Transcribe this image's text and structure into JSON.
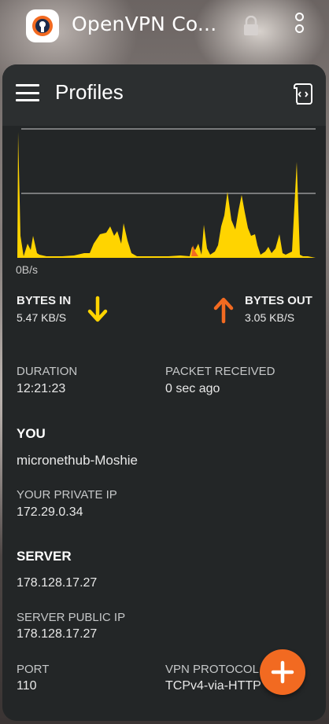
{
  "window": {
    "app_title": "OpenVPN Co...",
    "icons": [
      "openvpn-logo",
      "lock-icon",
      "overflow-menu-icon"
    ]
  },
  "appbar": {
    "title": "Profiles",
    "icons": [
      "hamburger-menu-icon",
      "log-icon"
    ]
  },
  "graph": {
    "axis_label": "0B/s",
    "colors": {
      "incoming": "#ffd400",
      "outgoing": "#f26a21",
      "grid": "#cfcfcf"
    }
  },
  "traffic": {
    "bytes_in_label": "BYTES IN",
    "bytes_in_value": "5.47 KB/S",
    "bytes_out_label": "BYTES OUT",
    "bytes_out_value": "3.05 KB/S"
  },
  "stats": {
    "duration_label": "DURATION",
    "duration_value": "12:21:23",
    "packet_label": "PACKET RECEIVED",
    "packet_value": "0 sec ago"
  },
  "you": {
    "section": "YOU",
    "username": "micronethub-Moshie",
    "private_ip_label": "YOUR PRIVATE IP",
    "private_ip_value": "172.29.0.34"
  },
  "server": {
    "section": "SERVER",
    "address": "178.128.17.27",
    "public_ip_label": "SERVER PUBLIC IP",
    "public_ip_value": "178.128.17.27",
    "port_label": "PORT",
    "port_value": "110",
    "protocol_label": "VPN PROTOCOL",
    "protocol_value": "TCPv4-via-HTTP"
  },
  "fab": {
    "icon": "plus-icon",
    "color": "#f26a21"
  }
}
